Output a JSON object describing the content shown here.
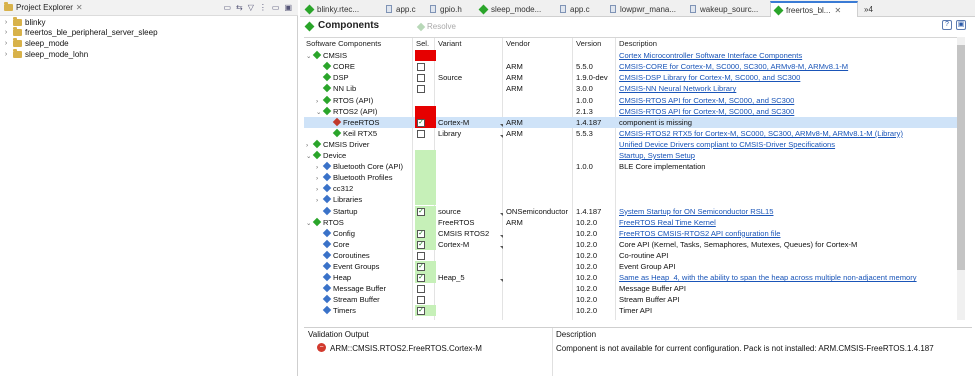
{
  "project_explorer": {
    "title": "Project Explorer",
    "close": "✕",
    "tools": [
      "▭",
      "⇆",
      "▽",
      "⋮",
      "▭",
      "▣"
    ],
    "items": [
      {
        "label": "blinky"
      },
      {
        "label": "freertos_ble_peripheral_server_sleep"
      },
      {
        "label": "sleep_mode"
      },
      {
        "label": "sleep_mode_lohn"
      }
    ]
  },
  "editor_tabs": [
    {
      "label": "blinky.rtec...",
      "icon": "component-icon"
    },
    {
      "label": "app.c",
      "icon": "file-icon"
    },
    {
      "label": "gpio.h",
      "icon": "file-icon"
    },
    {
      "label": "sleep_mode...",
      "icon": "component-icon"
    },
    {
      "label": "app.c",
      "icon": "file-icon"
    },
    {
      "label": "lowpwr_mana...",
      "icon": "file-icon"
    },
    {
      "label": "wakeup_sourc...",
      "icon": "file-icon"
    },
    {
      "label": "freertos_bl...",
      "icon": "component-icon",
      "active": true,
      "close": "✕"
    },
    {
      "label": "»4",
      "icon": ""
    }
  ],
  "components": {
    "title": "Components",
    "resolve_label": "Resolve",
    "help_icon": "?",
    "save_icon": "▣"
  },
  "columns": [
    "Software Components",
    "Sel.",
    "Variant",
    "Vendor",
    "Version",
    "Description"
  ],
  "rows": [
    {
      "indent": 0,
      "chev": "⌄",
      "icon": "green",
      "name": "CMSIS",
      "sel": "red",
      "variant": "",
      "vendor": "",
      "version": "",
      "desc": "Cortex Microcontroller Software Interface Components",
      "link": true
    },
    {
      "indent": 1,
      "chev": "",
      "icon": "green",
      "name": "CORE",
      "sel": "box",
      "variant": "",
      "vendor": "ARM",
      "version": "5.5.0",
      "desc": "CMSIS-CORE for Cortex-M, SC000, SC300, ARMv8-M, ARMv8.1-M",
      "link": true
    },
    {
      "indent": 1,
      "chev": "",
      "icon": "green",
      "name": "DSP",
      "sel": "box",
      "variant": "Source",
      "vendor": "ARM",
      "version": "1.9.0-dev",
      "desc": "CMSIS-DSP Library for Cortex-M, SC000, and SC300",
      "link": true
    },
    {
      "indent": 1,
      "chev": "",
      "icon": "green",
      "name": "NN Lib",
      "sel": "box",
      "variant": "",
      "vendor": "ARM",
      "version": "3.0.0",
      "desc": "CMSIS-NN Neural Network Library",
      "link": true
    },
    {
      "indent": 1,
      "chev": "›",
      "icon": "green",
      "name": "RTOS (API)",
      "sel": "",
      "variant": "",
      "vendor": "",
      "version": "1.0.0",
      "desc": "CMSIS-RTOS API for Cortex-M, SC000, and SC300",
      "link": true
    },
    {
      "indent": 1,
      "chev": "⌄",
      "icon": "green",
      "name": "RTOS2 (API)",
      "sel": "red",
      "variant": "",
      "vendor": "",
      "version": "2.1.3",
      "desc": "CMSIS-RTOS API for Cortex-M, SC000, and SC300",
      "link": true
    },
    {
      "indent": 2,
      "chev": "",
      "icon": "red",
      "name": "FreeRTOS",
      "sel": "check-red",
      "variant": "Cortex-M",
      "vendor": "ARM",
      "version": "1.4.187",
      "desc": "component is missing",
      "link": false,
      "selected": true,
      "drop": true
    },
    {
      "indent": 2,
      "chev": "",
      "icon": "green",
      "name": "Keil RTX5",
      "sel": "box",
      "variant": "Library",
      "vendor": "ARM",
      "version": "5.5.3",
      "desc": "CMSIS-RTOS2 RTX5 for Cortex-M, SC000, SC300, ARMv8-M, ARMv8.1-M (Library)",
      "link": true,
      "drop": true
    },
    {
      "indent": 0,
      "chev": "›",
      "icon": "green",
      "name": "CMSIS Driver",
      "sel": "",
      "variant": "",
      "vendor": "",
      "version": "",
      "desc": "Unified Device Drivers compliant to CMSIS-Driver Specifications",
      "link": true
    },
    {
      "indent": 0,
      "chev": "⌄",
      "icon": "green",
      "name": "Device",
      "sel": "green",
      "variant": "",
      "vendor": "",
      "version": "",
      "desc": "Startup, System Setup",
      "link": true
    },
    {
      "indent": 1,
      "chev": "›",
      "icon": "blue",
      "name": "Bluetooth Core (API)",
      "sel": "green",
      "variant": "",
      "vendor": "",
      "version": "1.0.0",
      "desc": "BLE Core implementation",
      "link": false
    },
    {
      "indent": 1,
      "chev": "›",
      "icon": "blue",
      "name": "Bluetooth Profiles",
      "sel": "green",
      "variant": "",
      "vendor": "",
      "version": "",
      "desc": "",
      "link": false
    },
    {
      "indent": 1,
      "chev": "›",
      "icon": "blue",
      "name": "cc312",
      "sel": "green",
      "variant": "",
      "vendor": "",
      "version": "",
      "desc": "",
      "link": false
    },
    {
      "indent": 1,
      "chev": "›",
      "icon": "blue",
      "name": "Libraries",
      "sel": "green",
      "variant": "",
      "vendor": "",
      "version": "",
      "desc": "",
      "link": false
    },
    {
      "indent": 1,
      "chev": "",
      "icon": "blue",
      "name": "Startup",
      "sel": "check",
      "variant": "source",
      "vendor": "ONSemiconductor",
      "version": "1.4.187",
      "desc": "System Startup for ON Semiconductor RSL15",
      "link": true,
      "drop": true
    },
    {
      "indent": 0,
      "chev": "⌄",
      "icon": "green",
      "name": "RTOS",
      "sel": "green",
      "variant": "FreeRTOS",
      "vendor": "ARM",
      "version": "10.2.0",
      "desc": "FreeRTOS Real Time Kernel",
      "link": true
    },
    {
      "indent": 1,
      "chev": "",
      "icon": "blue",
      "name": "Config",
      "sel": "check",
      "variant": "CMSIS RTOS2",
      "vendor": "",
      "version": "10.2.0",
      "desc": "FreeRTOS CMSIS-RTOS2 API configuration file",
      "link": true,
      "drop": true
    },
    {
      "indent": 1,
      "chev": "",
      "icon": "blue",
      "name": "Core",
      "sel": "check",
      "variant": "Cortex-M",
      "vendor": "",
      "version": "10.2.0",
      "desc": "Core API (Kernel, Tasks, Semaphores, Mutexes, Queues) for Cortex-M",
      "link": false,
      "drop": true
    },
    {
      "indent": 1,
      "chev": "",
      "icon": "blue",
      "name": "Coroutines",
      "sel": "box",
      "variant": "",
      "vendor": "",
      "version": "10.2.0",
      "desc": "Co-routine API",
      "link": false
    },
    {
      "indent": 1,
      "chev": "",
      "icon": "blue",
      "name": "Event Groups",
      "sel": "check",
      "variant": "",
      "vendor": "",
      "version": "10.2.0",
      "desc": "Event Group API",
      "link": false
    },
    {
      "indent": 1,
      "chev": "",
      "icon": "blue",
      "name": "Heap",
      "sel": "check",
      "variant": "Heap_5",
      "vendor": "",
      "version": "10.2.0",
      "desc": "Same as Heap_4, with the ability to span the heap across multiple non-adjacent memory",
      "link": true,
      "drop": true
    },
    {
      "indent": 1,
      "chev": "",
      "icon": "blue",
      "name": "Message Buffer",
      "sel": "box",
      "variant": "",
      "vendor": "",
      "version": "10.2.0",
      "desc": "Message Buffer API",
      "link": false
    },
    {
      "indent": 1,
      "chev": "",
      "icon": "blue",
      "name": "Stream Buffer",
      "sel": "box",
      "variant": "",
      "vendor": "",
      "version": "10.2.0",
      "desc": "Stream Buffer API",
      "link": false
    },
    {
      "indent": 1,
      "chev": "",
      "icon": "blue",
      "name": "Timers",
      "sel": "check",
      "variant": "",
      "vendor": "",
      "version": "10.2.0",
      "desc": "Timer API",
      "link": false
    }
  ],
  "validation": {
    "col_output": "Validation Output",
    "col_desc": "Description",
    "item": "ARM::CMSIS.RTOS2.FreeRTOS.Cortex-M",
    "item_desc": "Component is not available for current configuration. Pack is not installed: ARM.CMSIS-FreeRTOS.1.4.187"
  },
  "colors": {
    "sel_red": "#e60000",
    "sel_green": "#c6f0b8",
    "link": "#1a55b8",
    "selected_row": "#cfe3f8"
  }
}
